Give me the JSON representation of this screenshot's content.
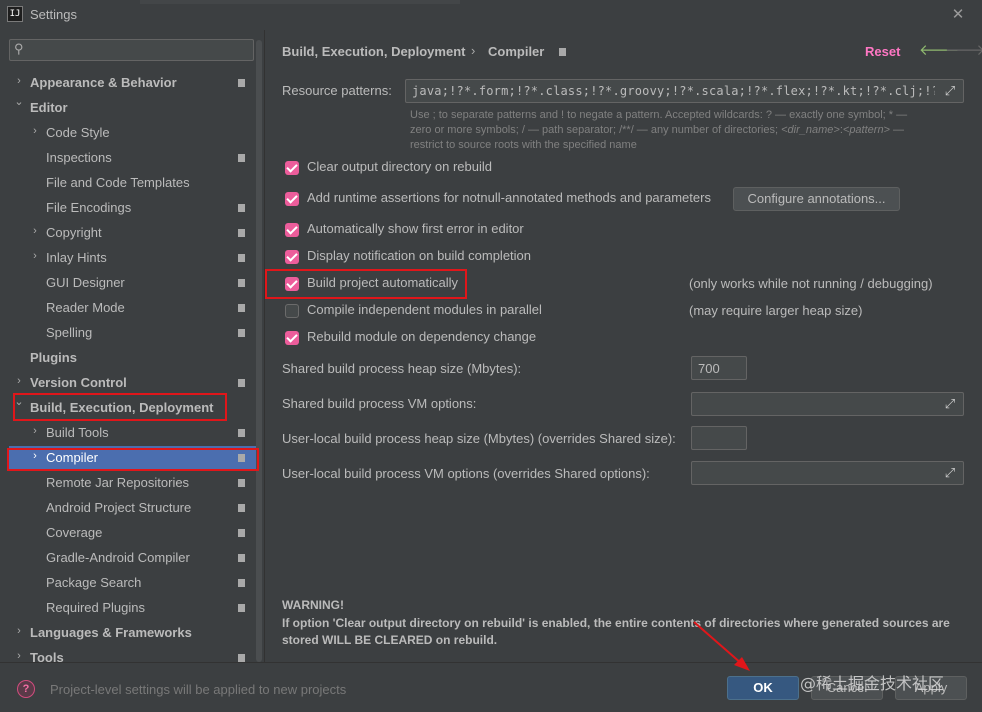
{
  "window": {
    "title": "Settings",
    "app_icon": "ij-logo",
    "close_icon": "close-icon"
  },
  "sidebar": {
    "search_placeholder": "",
    "search_icon": "search-icon",
    "items": [
      {
        "label": "Appearance & Behavior",
        "level": 0,
        "arrow": "right",
        "bold": true,
        "proj": true
      },
      {
        "label": "Editor",
        "level": 0,
        "arrow": "down",
        "bold": true,
        "proj": false
      },
      {
        "label": "Code Style",
        "level": 1,
        "arrow": "right",
        "bold": false,
        "proj": false
      },
      {
        "label": "Inspections",
        "level": 1,
        "arrow": "",
        "bold": false,
        "proj": true
      },
      {
        "label": "File and Code Templates",
        "level": 1,
        "arrow": "",
        "bold": false,
        "proj": false
      },
      {
        "label": "File Encodings",
        "level": 1,
        "arrow": "",
        "bold": false,
        "proj": true
      },
      {
        "label": "Copyright",
        "level": 1,
        "arrow": "right",
        "bold": false,
        "proj": true
      },
      {
        "label": "Inlay Hints",
        "level": 1,
        "arrow": "right",
        "bold": false,
        "proj": true
      },
      {
        "label": "GUI Designer",
        "level": 1,
        "arrow": "",
        "bold": false,
        "proj": true
      },
      {
        "label": "Reader Mode",
        "level": 1,
        "arrow": "",
        "bold": false,
        "proj": true
      },
      {
        "label": "Spelling",
        "level": 1,
        "arrow": "",
        "bold": false,
        "proj": true
      },
      {
        "label": "Plugins",
        "level": 0,
        "arrow": "",
        "bold": true,
        "proj": false
      },
      {
        "label": "Version Control",
        "level": 0,
        "arrow": "right",
        "bold": true,
        "proj": true
      },
      {
        "label": "Build, Execution, Deployment",
        "level": 0,
        "arrow": "down",
        "bold": true,
        "proj": false
      },
      {
        "label": "Build Tools",
        "level": 1,
        "arrow": "right",
        "bold": false,
        "proj": true
      },
      {
        "label": "Compiler",
        "level": 1,
        "arrow": "right",
        "bold": false,
        "proj": true,
        "selected": true
      },
      {
        "label": "Remote Jar Repositories",
        "level": 1,
        "arrow": "",
        "bold": false,
        "proj": true
      },
      {
        "label": "Android Project Structure",
        "level": 1,
        "arrow": "",
        "bold": false,
        "proj": true
      },
      {
        "label": "Coverage",
        "level": 1,
        "arrow": "",
        "bold": false,
        "proj": true
      },
      {
        "label": "Gradle-Android Compiler",
        "level": 1,
        "arrow": "",
        "bold": false,
        "proj": true
      },
      {
        "label": "Package Search",
        "level": 1,
        "arrow": "",
        "bold": false,
        "proj": true
      },
      {
        "label": "Required Plugins",
        "level": 1,
        "arrow": "",
        "bold": false,
        "proj": true
      },
      {
        "label": "Languages & Frameworks",
        "level": 0,
        "arrow": "right",
        "bold": true,
        "proj": false
      },
      {
        "label": "Tools",
        "level": 0,
        "arrow": "right",
        "bold": true,
        "proj": true
      }
    ]
  },
  "header": {
    "crumb_parent": "Build, Execution, Deployment",
    "crumb_separator": "›",
    "crumb_current": "Compiler",
    "reset_label": "Reset",
    "back_icon": "arrow-left-icon",
    "forward_icon": "arrow-right-icon"
  },
  "resource": {
    "label": "Resource patterns:",
    "value": "java;!?*.form;!?*.class;!?*.groovy;!?*.scala;!?*.flex;!?*.kt;!?*.clj;!?*.aj",
    "hint_1": "Use ; to separate patterns and ! to negate a pattern. Accepted wildcards: ? — exactly one symbol; * —",
    "hint_2": "zero or more symbols; / — path separator; /**/ — any number of directories; ",
    "hint_dir": "<dir_name>",
    "hint_colon": ":",
    "hint_pattern": "<pattern>",
    "hint_dash": " —",
    "hint_3": "restrict to source roots with the specified name"
  },
  "options": {
    "clear_output": {
      "label": "Clear output directory on rebuild",
      "checked": true
    },
    "runtime_assertions": {
      "label": "Add runtime assertions for notnull-annotated methods and parameters",
      "checked": true
    },
    "configure_btn": "Configure annotations...",
    "show_first_error": {
      "label": "Automatically show first error in editor",
      "checked": true
    },
    "display_notification": {
      "label": "Display notification on build completion",
      "checked": true
    },
    "build_auto": {
      "label": "Build project automatically",
      "checked": true,
      "note": "(only works while not running / debugging)"
    },
    "compile_parallel": {
      "label": "Compile independent modules in parallel",
      "checked": false,
      "note": "(may require larger heap size)"
    },
    "rebuild_on_dep": {
      "label": "Rebuild module on dependency change",
      "checked": true
    }
  },
  "fields": {
    "shared_heap_label": "Shared build process heap size (Mbytes):",
    "shared_heap_value": "700",
    "shared_vm_label": "Shared build process VM options:",
    "shared_vm_value": "",
    "user_heap_label": "User-local build process heap size (Mbytes) (overrides Shared size):",
    "user_heap_value": "",
    "user_vm_label": "User-local build process VM options (overrides Shared options):",
    "user_vm_value": "",
    "expand_icon": "expand-icon"
  },
  "warning": {
    "title": "WARNING!",
    "text": "If option 'Clear output directory on rebuild' is enabled, the entire contents of directories where generated sources are stored WILL BE CLEARED on rebuild."
  },
  "footer": {
    "help_icon": "help-icon",
    "note": "Project-level settings will be applied to new projects",
    "ok": "OK",
    "cancel": "Cancel",
    "apply": "Apply"
  },
  "watermark": "@稀土掘金技术社区",
  "colors": {
    "background": "#3c3f41",
    "selection": "#4b6eaf",
    "checkbox": "#ec5d9b",
    "reset": "#ff77c4",
    "annotation_red": "#e0161a",
    "primary_button": "#365880"
  }
}
